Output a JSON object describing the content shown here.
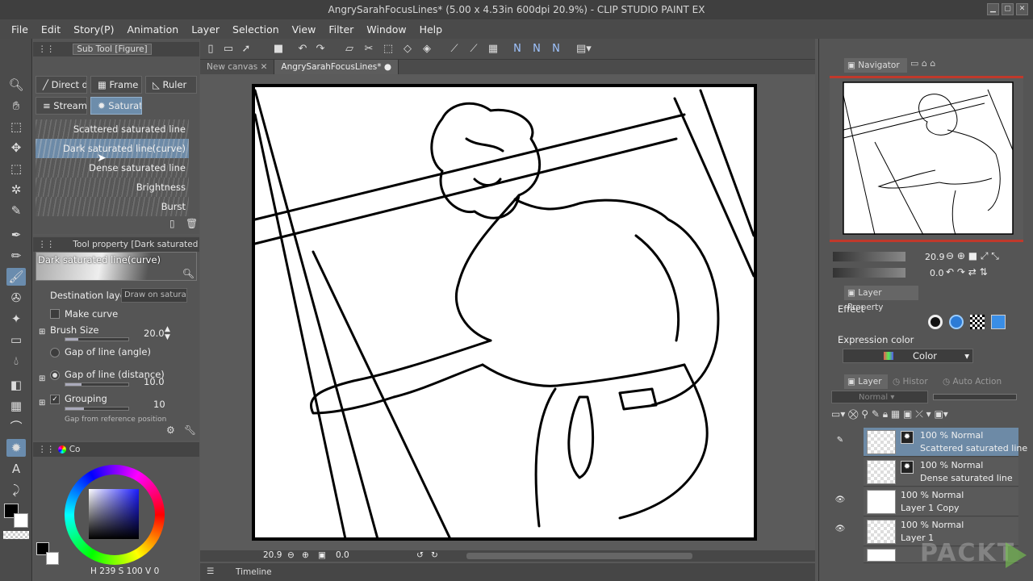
{
  "window": {
    "title": "AngrySarahFocusLines* (5.00 x 4.53in 600dpi 20.9%)  - CLIP STUDIO PAINT EX"
  },
  "menu": [
    "File",
    "Edit",
    "Story(P)",
    "Animation",
    "Layer",
    "Selection",
    "View",
    "Filter",
    "Window",
    "Help"
  ],
  "sub_tool": {
    "header": "Sub Tool [Figure]",
    "tabs": [
      "Direct d",
      "Frame b",
      "Ruler",
      "Stream",
      "Saturate"
    ],
    "presets": [
      "Scattered saturated line",
      "Dark saturated line(curve)",
      "Dense saturated line",
      "Brightness",
      "Burst"
    ]
  },
  "tool_property": {
    "header": "Tool property [Dark saturated line(c",
    "preview_label": "Dark saturated line(curve)",
    "destination_layer_label": "Destination layer",
    "destination_layer_value": "Draw on satura",
    "make_curve_label": "Make curve",
    "brush_size_label": "Brush Size",
    "brush_size_value": "20.0",
    "gap_angle_label": "Gap of line (angle)",
    "gap_distance_label": "Gap of line (distance)",
    "gap_distance_value": "10.0",
    "grouping_label": "Grouping",
    "grouping_value": "10",
    "gap_reference_label": "Gap from reference position"
  },
  "color_panel": {
    "tab_label": "Co",
    "hsv": {
      "h_label": "H",
      "h": "239",
      "s_label": "S",
      "s": "100",
      "v_label": "V",
      "v": "0"
    }
  },
  "document_tabs": [
    "New canvas",
    "AngrySarahFocusLines*"
  ],
  "status": {
    "zoom": "20.9",
    "rotation": "0.0"
  },
  "timeline": {
    "label": "Timeline"
  },
  "navigator": {
    "tab": "Navigator",
    "zoom": "20.9",
    "rotation": "0.0"
  },
  "layer_property": {
    "tab": "Layer Property",
    "effect_label": "Effect",
    "expression_color_label": "Expression color",
    "expression_color_value": "Color"
  },
  "layer_panel": {
    "tabs": [
      "Layer",
      "Histor",
      "Auto Action"
    ],
    "blend_mode": "Normal",
    "layers": [
      {
        "opacity": "100 %",
        "mode": "Normal",
        "name": "Scattered saturated line",
        "selected": true
      },
      {
        "opacity": "100 %",
        "mode": "Normal",
        "name": "Dense saturated line",
        "selected": false
      },
      {
        "opacity": "100 %",
        "mode": "Normal",
        "name": "Layer 1 Copy",
        "selected": false
      },
      {
        "opacity": "100 %",
        "mode": "Normal",
        "name": "Layer 1",
        "selected": false
      }
    ]
  },
  "watermark": "PACKT",
  "colors": {
    "accent": "#6d8dab",
    "panel": "#555555",
    "titlebar": "#3f3f3f",
    "navigator_frame": "#c0392b"
  }
}
